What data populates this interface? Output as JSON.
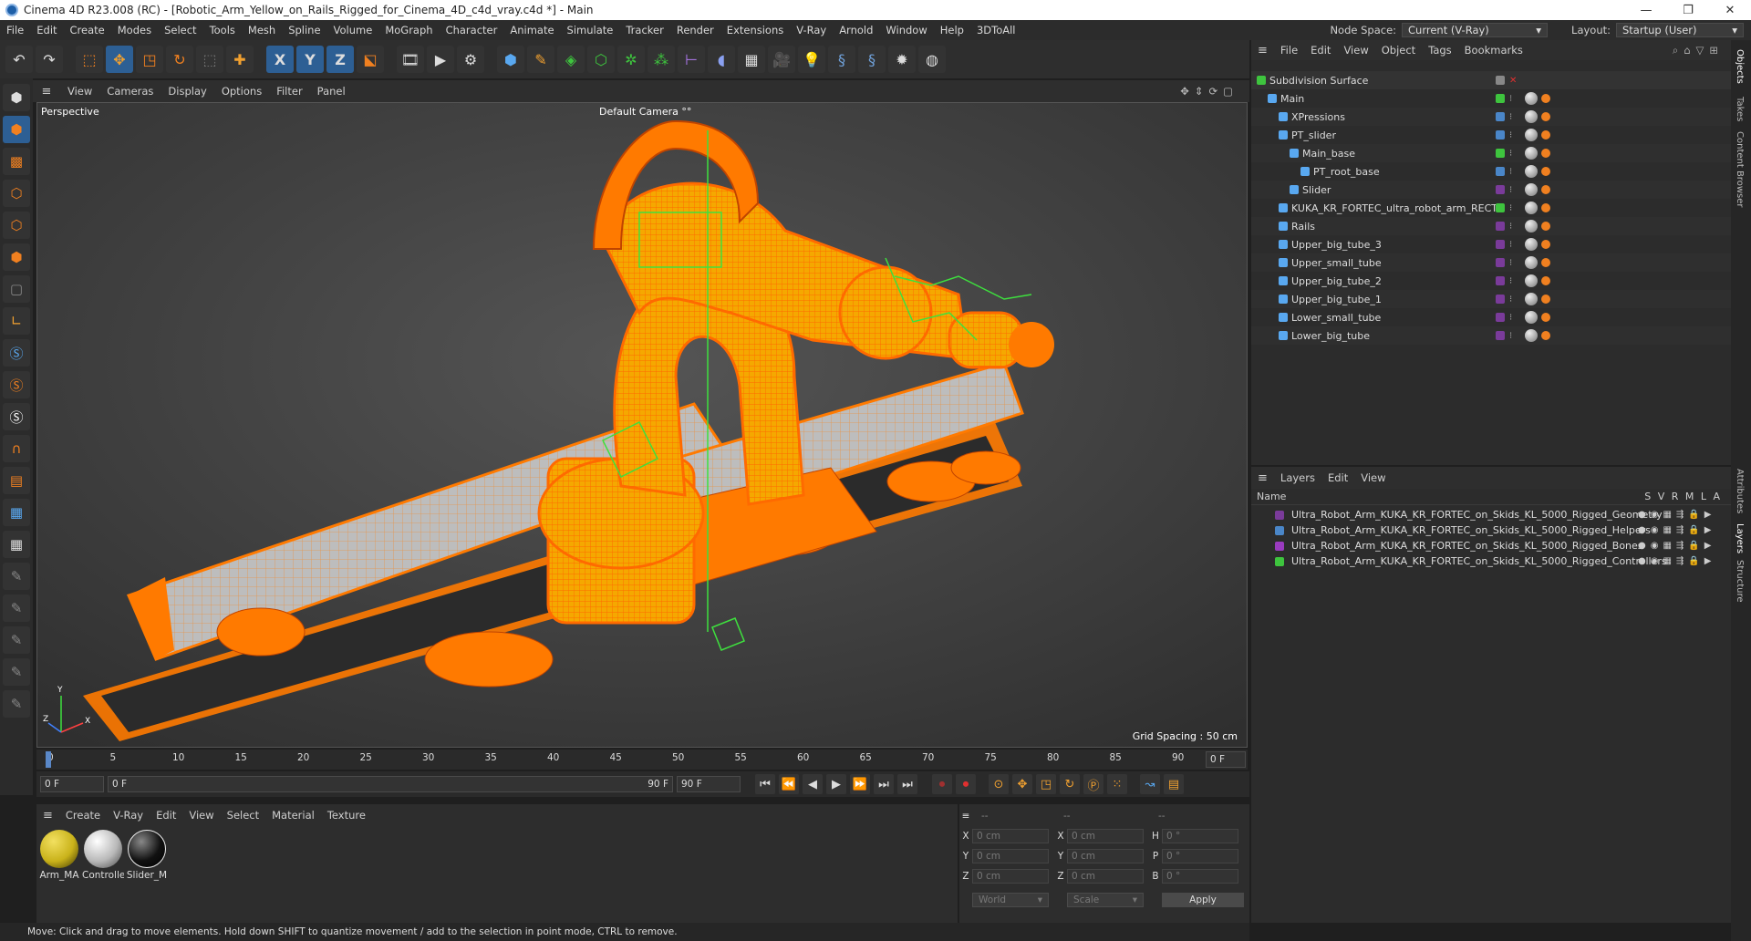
{
  "window": {
    "title": "Cinema 4D R23.008 (RC) - [Robotic_Arm_Yellow_on_Rails_Rigged_for_Cinema_4D_c4d_vray.c4d *] - Main",
    "controls": [
      "—",
      "❐",
      "✕"
    ]
  },
  "menubar": {
    "items": [
      "File",
      "Edit",
      "Create",
      "Modes",
      "Select",
      "Tools",
      "Mesh",
      "Spline",
      "Volume",
      "MoGraph",
      "Character",
      "Animate",
      "Simulate",
      "Tracker",
      "Render",
      "Extensions",
      "V-Ray",
      "Arnold",
      "Window",
      "Help",
      "3DToAll"
    ],
    "node_space_label": "Node Space:",
    "node_space_value": "Current (V-Ray)",
    "layout_label": "Layout:",
    "layout_value": "Startup (User)"
  },
  "toolbar": {
    "icons": [
      "undo-icon",
      "redo-icon",
      "select-icon",
      "move-icon",
      "scale-icon",
      "rotate-icon",
      "live-select-icon",
      "add-icon",
      "x-axis-icon",
      "y-axis-icon",
      "z-axis-icon",
      "world-coords-icon",
      "render-region-icon",
      "render-view-icon",
      "render-settings-icon",
      "cube-icon",
      "pen-icon",
      "subdivision-icon",
      "extrude-icon",
      "cloner-icon",
      "mograph-icon",
      "measure-icon",
      "deformer-icon",
      "floor-icon",
      "camera-icon",
      "light-icon",
      "python-icon",
      "python2-icon",
      "gear-icon",
      "sphere-grid-icon"
    ],
    "x_label": "X",
    "y_label": "Y",
    "z_label": "Z"
  },
  "viewport": {
    "menu": [
      "View",
      "Cameras",
      "Display",
      "Options",
      "Filter",
      "Panel"
    ],
    "projection": "Perspective",
    "camera": "Default Camera",
    "camera_suffix": "°°",
    "grid_spacing": "Grid Spacing : 50 cm",
    "accent": "#ff7a00"
  },
  "timeline": {
    "ticks": [
      "0",
      "5",
      "10",
      "15",
      "20",
      "25",
      "30",
      "35",
      "40",
      "45",
      "50",
      "55",
      "60",
      "65",
      "70",
      "75",
      "80",
      "85",
      "90"
    ],
    "current_frame": "0 F"
  },
  "transport": {
    "start_field": "0 F",
    "min_field": "0 F",
    "max_field": "90 F",
    "end_field": "90 F"
  },
  "materials": {
    "menu": [
      "Create",
      "V-Ray",
      "Edit",
      "View",
      "Select",
      "Material",
      "Texture"
    ],
    "items": [
      {
        "label": "Arm_MA",
        "color": "#c9b21a"
      },
      {
        "label": "Controlle",
        "color": "#d8d8d8"
      },
      {
        "label": "Slider_M",
        "color": "#111111"
      }
    ]
  },
  "coordinates": {
    "header": [
      "--",
      "--",
      "--"
    ],
    "rows": [
      {
        "a": "X",
        "v1": "0 cm",
        "b": "X",
        "v2": "0 cm",
        "c": "H",
        "v3": "0 °"
      },
      {
        "a": "Y",
        "v1": "0 cm",
        "b": "Y",
        "v2": "0 cm",
        "c": "P",
        "v3": "0 °"
      },
      {
        "a": "Z",
        "v1": "0 cm",
        "b": "Z",
        "v2": "0 cm",
        "c": "B",
        "v3": "0 °"
      }
    ],
    "mode_world": "World",
    "mode_scale": "Scale",
    "apply": "Apply"
  },
  "status": "Move: Click and drag to move elements. Hold down SHIFT to quantize movement / add to the selection in point mode, CTRL to remove.",
  "objects": {
    "menu": [
      "File",
      "Edit",
      "View",
      "Object",
      "Tags",
      "Bookmarks"
    ],
    "root": "Subdivision Surface",
    "rows": [
      {
        "name": "Main",
        "indent": 1,
        "color": "#3ec43e"
      },
      {
        "name": "XPressions",
        "indent": 2,
        "color": "#4a86c8"
      },
      {
        "name": "PT_slider",
        "indent": 2,
        "color": "#4a86c8"
      },
      {
        "name": "Main_base",
        "indent": 3,
        "color": "#3ec43e"
      },
      {
        "name": "PT_root_base",
        "indent": 4,
        "color": "#4a86c8"
      },
      {
        "name": "Slider",
        "indent": 3,
        "color": "#7a3b9a"
      },
      {
        "name": "KUKA_KR_FORTEC_ultra_robot_arm_RECT",
        "indent": 2,
        "color": "#3ec43e"
      },
      {
        "name": "Rails",
        "indent": 2,
        "color": "#7a3b9a"
      },
      {
        "name": "Upper_big_tube_3",
        "indent": 2,
        "color": "#7a3b9a"
      },
      {
        "name": "Upper_small_tube",
        "indent": 2,
        "color": "#7a3b9a"
      },
      {
        "name": "Upper_big_tube_2",
        "indent": 2,
        "color": "#7a3b9a"
      },
      {
        "name": "Upper_big_tube_1",
        "indent": 2,
        "color": "#7a3b9a"
      },
      {
        "name": "Lower_small_tube",
        "indent": 2,
        "color": "#7a3b9a"
      },
      {
        "name": "Lower_big_tube",
        "indent": 2,
        "color": "#7a3b9a"
      }
    ]
  },
  "layers": {
    "menu": [
      "Layers",
      "Edit",
      "View"
    ],
    "header_name": "Name",
    "header_flags": "S V R M L A",
    "rows": [
      {
        "name": "Ultra_Robot_Arm_KUKA_KR_FORTEC_on_Skids_KL_5000_Rigged_Geometry",
        "color": "#7a3b9a"
      },
      {
        "name": "Ultra_Robot_Arm_KUKA_KR_FORTEC_on_Skids_KL_5000_Rigged_Helpers",
        "color": "#4a86c8"
      },
      {
        "name": "Ultra_Robot_Arm_KUKA_KR_FORTEC_on_Skids_KL_5000_Rigged_Bones",
        "color": "#9a3bbf"
      },
      {
        "name": "Ultra_Robot_Arm_KUKA_KR_FORTEC_on_Skids_KL_5000_Rigged_Controllers",
        "color": "#3ec43e"
      }
    ]
  },
  "side_tabs": [
    "Objects",
    "Takes",
    "Content Browser",
    "Attributes",
    "Layers",
    "Structure"
  ]
}
